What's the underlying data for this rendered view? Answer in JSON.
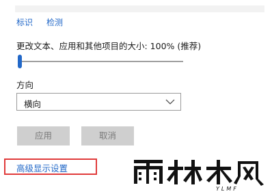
{
  "links": {
    "identify": "标识",
    "detect": "检测"
  },
  "scale": {
    "label": "更改文本、应用和其他项目的大小: 100% (推荐)",
    "slider_fraction": 0
  },
  "orientation": {
    "label": "方向",
    "selected": "横向"
  },
  "buttons": {
    "apply": "应用",
    "cancel": "取消"
  },
  "advanced": {
    "label": "高级显示设置",
    "highlight_color": "#e03a3a"
  },
  "watermark": {
    "brand_text": "雨林木风",
    "sub_text": "YLMF"
  },
  "colors": {
    "accent": "#2268c8",
    "button_bg": "#cfcfcf"
  }
}
